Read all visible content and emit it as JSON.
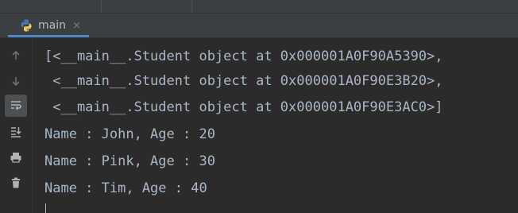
{
  "tab": {
    "label": "main",
    "close_glyph": "×",
    "icon": "python-icon"
  },
  "gutter": {
    "buttons": [
      {
        "name": "up-arrow-icon"
      },
      {
        "name": "down-arrow-icon"
      },
      {
        "name": "soft-wrap-icon",
        "active": true
      },
      {
        "name": "scroll-to-end-icon"
      },
      {
        "name": "print-icon"
      },
      {
        "name": "trash-icon"
      }
    ]
  },
  "console": {
    "lines": [
      "[<__main__.Student object at 0x000001A0F90A5390>,",
      " <__main__.Student object at 0x000001A0F90E3B20>,",
      " <__main__.Student object at 0x000001A0F90E3AC0>]",
      "Name : John, Age : 20",
      "Name : Pink, Age : 30",
      "Name : Tim, Age : 40"
    ]
  },
  "colors": {
    "background": "#2b2b2b",
    "panel": "#3c3f41",
    "text": "#a9b7c6",
    "tab_accent": "#4a88c7"
  }
}
